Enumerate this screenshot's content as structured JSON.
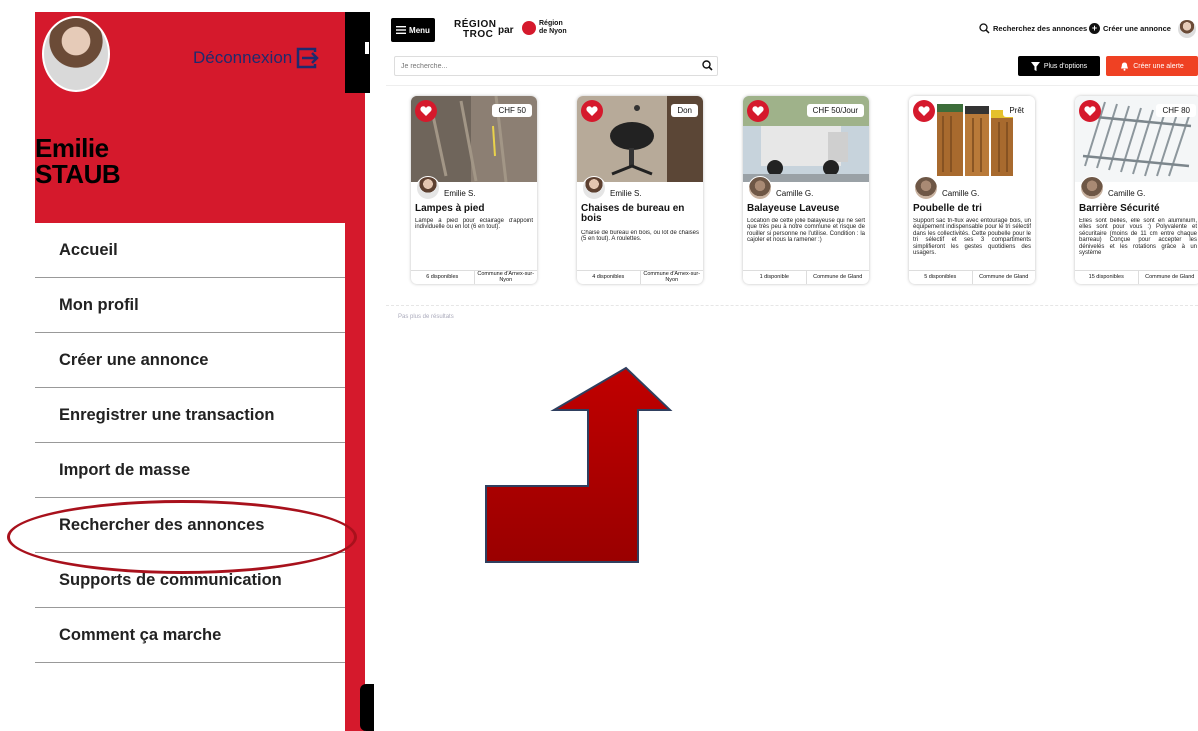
{
  "menu_panel": {
    "user_first_name": "Emilie",
    "user_last_name": "STAUB",
    "logout_label": "Déconnexion",
    "items": [
      {
        "label": "Accueil"
      },
      {
        "label": "Mon profil"
      },
      {
        "label": "Créer une annonce"
      },
      {
        "label": "Enregistrer une transaction"
      },
      {
        "label": "Import de masse"
      },
      {
        "label": "Rechercher des annonces"
      },
      {
        "label": "Supports de communication"
      },
      {
        "label": "Comment ça marche"
      }
    ],
    "highlighted_item": "Rechercher des annonces"
  },
  "app": {
    "menu_button_label": "Menu",
    "logo_line1": "RÉGION",
    "logo_line2": "TROC",
    "logo_par": "par",
    "logo_region_line1": "Région",
    "logo_region_line2": "de Nyon",
    "top_search_label": "Recherchez des annonces",
    "top_create_label": "Créer une annonce",
    "search_placeholder": "Je recherche...",
    "options_button_label": "Plus d'options",
    "alert_button_label": "Créer une alerte",
    "no_more_results": "Pas plus de résultats",
    "cards": [
      {
        "price": "CHF 50",
        "owner": "Emilie S.",
        "title": "Lampes à pied",
        "description": "Lampe à pied pour éclairage d'appoint individuelle ou en lot (6 en tout).",
        "availability": "6 disponibles",
        "location": "Commune d'Arnex-sur-Nyon"
      },
      {
        "price": "Don",
        "owner": "Emilie S.",
        "title": "Chaises de bureau en bois",
        "description": "Chaise de bureau en bois, ou lot de chaises (5 en tout). A roulettes.",
        "availability": "4 disponibles",
        "location": "Commune d'Arnex-sur-Nyon"
      },
      {
        "price": "CHF 50/Jour",
        "owner": "Camille G.",
        "title": "Balayeuse Laveuse",
        "description": "Location de cette jolie balayeuse qui ne sert que très peu à notre commune et risque de rouiller si personne ne l'utilise. Condition : la cajoler et nous la ramener :)",
        "availability": "1 disponible",
        "location": "Commune de Gland"
      },
      {
        "price": "Prêt",
        "owner": "Camille G.",
        "title": "Poubelle de tri",
        "description": "Support sac tri-flux avec entourage bois, un équipement indispensable pour le tri sélectif dans les collectivités. Cette poubelle pour le tri sélectif et ses 3 compartiments simplifieront les gestes quotidiens des usagers.",
        "availability": "5 disponibles",
        "location": "Commune de Gland"
      },
      {
        "price": "CHF 80",
        "owner": "Camille G.",
        "title": "Barrière Sécurité",
        "description": "Elles sont belles, elle sont en aluminium, elles sont pour vous :) Polyvalente et sécuritaire (moins de 11 cm entre chaque barreau) Conçue pour accepter les dénivelés et les rotations grâce à un système",
        "availability": "15 disponibles",
        "location": "Commune de Gland"
      }
    ]
  },
  "colors": {
    "brand_red": "#d5192c",
    "alert_orange": "#ef4123",
    "logout_navy": "#1f2a6e",
    "annotation_red": "#a8111c"
  }
}
